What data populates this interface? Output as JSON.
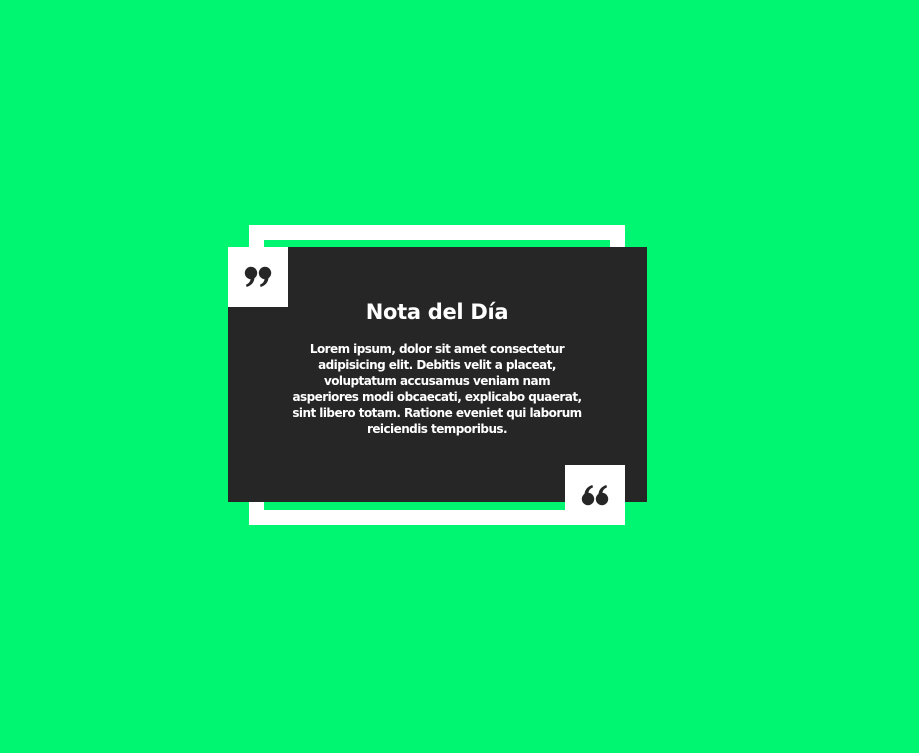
{
  "colors": {
    "background": "#00f571",
    "card": "#262626",
    "frame": "#ffffff",
    "text": "#ffffff"
  },
  "quote_card": {
    "title": "Nota del Día",
    "body": "Lorem ipsum, dolor sit amet consectetur adipisicing elit. Debitis velit a placeat, voluptatum accusamus veniam nam asperiores modi obcaecati, explicabo quaerat, sint libero totam. Ratione eveniet qui laborum reiciendis temporibus.",
    "open_icon": "quote-right-icon",
    "close_icon": "quote-left-icon"
  }
}
